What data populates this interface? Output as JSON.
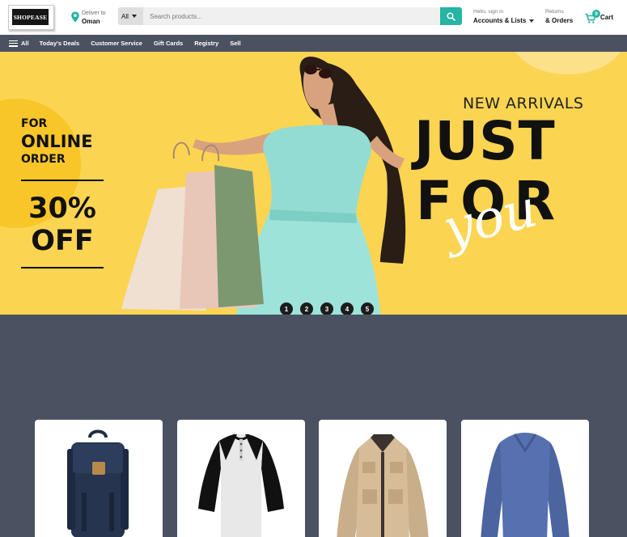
{
  "header": {
    "logo_text": "SHOPEASE",
    "deliver_label": "Deliver to",
    "deliver_location": "Oman",
    "search": {
      "category": "All",
      "placeholder": "Search products...",
      "button_icon": "search-icon"
    },
    "account": {
      "line1": "Hello, sign in",
      "line2": "Accounts & Lists"
    },
    "returns": {
      "line1": "Returns",
      "line2": "& Orders"
    },
    "cart": {
      "count": "0",
      "label": "Cart"
    },
    "colors": {
      "accent": "#25b5a2",
      "nav_bg": "#4a5262"
    }
  },
  "nav": {
    "menu_label": "All",
    "items": [
      "Today's Deals",
      "Customer Service",
      "Gift Cards",
      "Registry",
      "Sell"
    ]
  },
  "banner": {
    "promo_line1": "FOR",
    "promo_line2": "ONLINE",
    "promo_line3": "ORDER",
    "discount_value": "30%",
    "discount_word": "OFF",
    "headline_small": "NEW ARRIVALS",
    "headline_line1": "JUST",
    "headline_line2": "FOR",
    "headline_script": "you",
    "background_color": "#fbd452",
    "slides": [
      "1",
      "2",
      "3",
      "4",
      "5"
    ]
  },
  "products": [
    {
      "icon": "backpack-image"
    },
    {
      "icon": "raglan-tshirt-image"
    },
    {
      "icon": "jacket-image"
    },
    {
      "icon": "sweater-image"
    }
  ]
}
